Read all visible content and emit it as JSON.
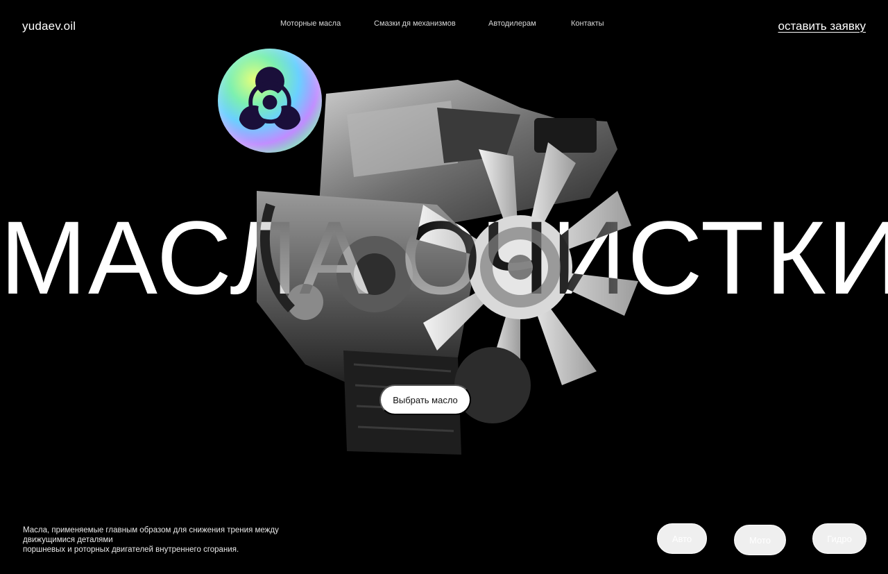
{
  "header": {
    "logo": "yudaev.oil",
    "nav": [
      "Моторные масла",
      "Смазки дя механизмов",
      "Автодилерам",
      "Контакты"
    ],
    "cta": "оставить заявку"
  },
  "hero": {
    "title": "МАСЛА ОЧИСТКИ",
    "button": "Выбрать масло",
    "badge_icon": "biohazard-icon"
  },
  "footer": {
    "description": [
      "Масла, применяемые главным образом для снижения трения между",
      "движущимися деталями",
      "поршневых и роторных двигателей внутреннего сгорания."
    ],
    "categories": [
      "Авто",
      "Мото",
      "Гидро"
    ]
  },
  "colors": {
    "background": "#000000",
    "text": "#ffffff"
  }
}
